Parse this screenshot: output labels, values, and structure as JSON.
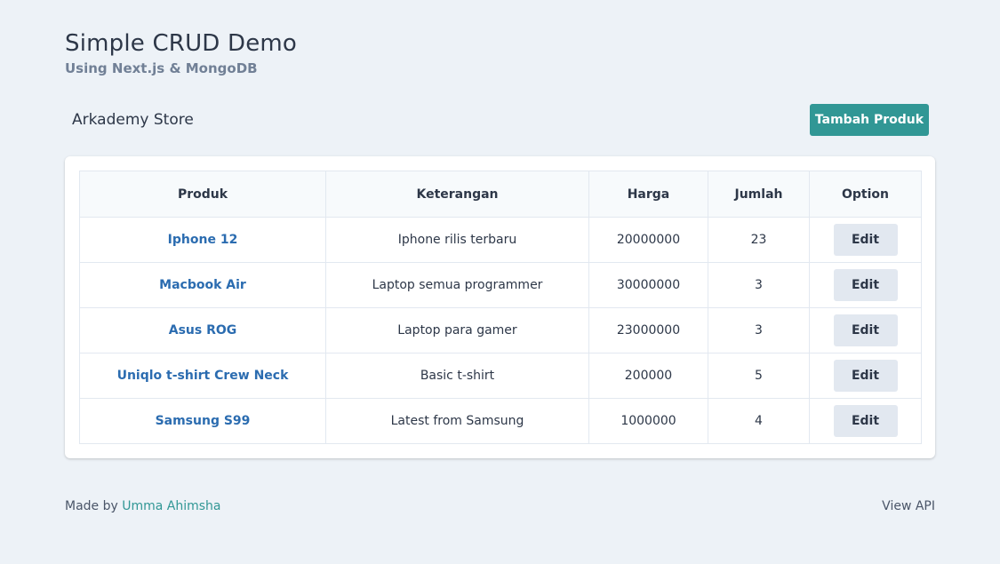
{
  "header": {
    "title": "Simple CRUD Demo",
    "subtitle": "Using Next.js & MongoDB"
  },
  "store": {
    "name": "Arkademy Store",
    "add_button": "Tambah Produk"
  },
  "table": {
    "columns": [
      "Produk",
      "Keterangan",
      "Harga",
      "Jumlah",
      "Option"
    ],
    "rows": [
      {
        "product": "Iphone 12",
        "description": "Iphone rilis terbaru",
        "price": "20000000",
        "qty": "23",
        "action": "Edit"
      },
      {
        "product": "Macbook Air",
        "description": "Laptop semua programmer",
        "price": "30000000",
        "qty": "3",
        "action": "Edit"
      },
      {
        "product": "Asus ROG",
        "description": "Laptop para gamer",
        "price": "23000000",
        "qty": "3",
        "action": "Edit"
      },
      {
        "product": "Uniqlo t-shirt Crew Neck",
        "description": "Basic t-shirt",
        "price": "200000",
        "qty": "5",
        "action": "Edit"
      },
      {
        "product": "Samsung S99",
        "description": "Latest from Samsung",
        "price": "1000000",
        "qty": "4",
        "action": "Edit"
      }
    ]
  },
  "footer": {
    "made_by": "Made by",
    "author": "Umma Ahimsha",
    "view_api": "View API"
  },
  "colors": {
    "accent": "#319795",
    "link": "#2b6cb0",
    "background": "#edf2f7"
  }
}
